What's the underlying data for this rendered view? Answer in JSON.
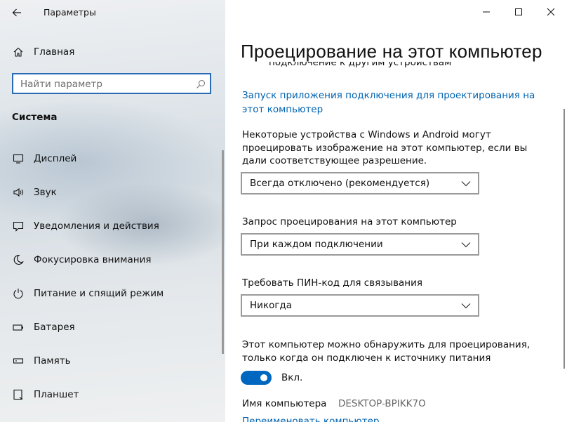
{
  "window": {
    "app_title": "Параметры",
    "controls": {
      "minimize": "minimize",
      "maximize": "maximize",
      "close": "close"
    }
  },
  "sidebar": {
    "home_label": "Главная",
    "search": {
      "placeholder": "Найти параметр",
      "value": ""
    },
    "section_title": "Система",
    "items": [
      {
        "label": "Дисплей",
        "icon": "display-icon"
      },
      {
        "label": "Звук",
        "icon": "speaker-icon"
      },
      {
        "label": "Уведомления и действия",
        "icon": "notification-icon"
      },
      {
        "label": "Фокусировка внимания",
        "icon": "moon-icon"
      },
      {
        "label": "Питание и спящий режим",
        "icon": "power-icon"
      },
      {
        "label": "Батарея",
        "icon": "battery-icon"
      },
      {
        "label": "Память",
        "icon": "storage-icon"
      },
      {
        "label": "Планшет",
        "icon": "tablet-icon"
      }
    ]
  },
  "main": {
    "title": "Проецирование на этот компьютер",
    "cut_text": "подключение к другим устройствам",
    "launch_link": "Запуск приложения подключения для проектирования на этот компьютер",
    "description": "Некоторые устройства с Windows и Android могут проецировать изображение на этот компьютер, если вы дали соответствующее разрешение.",
    "dropdown_availability": "Всегда отключено (рекомендуется)",
    "request_label": "Запрос проецирования на этот компьютер",
    "dropdown_request": "При каждом подключении",
    "pin_label": "Требовать ПИН-код для связывания",
    "dropdown_pin": "Никогда",
    "power_text": "Этот компьютер можно обнаружить для проецирования, только когда он подключен к источнику питания",
    "toggle_state": "Вкл.",
    "pc_name_label": "Имя компьютера",
    "pc_name_value": "DESKTOP-BPIKK7O",
    "rename_link": "Переименовать компьютер"
  },
  "colors": {
    "accent": "#0067c0",
    "link": "#0063b1",
    "search_border": "#2a6bb5"
  }
}
